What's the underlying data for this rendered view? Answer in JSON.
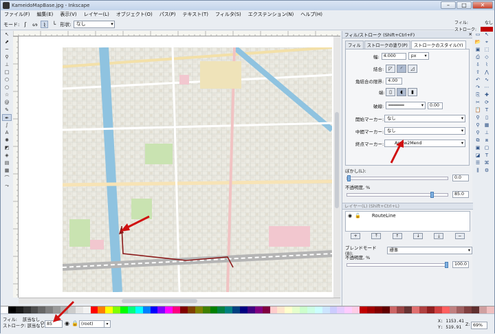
{
  "window": {
    "title": "KameidoMapBase.jpg - Inkscape"
  },
  "menu": [
    "ファイル(F)",
    "編集(E)",
    "表示(V)",
    "レイヤー(L)",
    "オブジェクト(O)",
    "パス(P)",
    "テキスト(T)",
    "フィルタ(S)",
    "エクステンション(N)",
    "ヘルプ(H)"
  ],
  "toolctl": {
    "mode_label": "モード:",
    "shape_label": "形状:",
    "shape_value": "なし"
  },
  "fs_indicator": {
    "fill_label": "フィル:",
    "fill_value": "なし",
    "stroke_label": "ストローク:",
    "stroke_color": "#c00000"
  },
  "dock": {
    "fillstroke_title": "フィル/ストローク (Shift+Ctrl+F)",
    "tabs": [
      "フィル",
      "ストロークの塗り(P)",
      "ストロークのスタイル(Y)"
    ],
    "width_label": "幅:",
    "width_value": "4.000",
    "width_unit": "px",
    "join_label": "結合:",
    "miter_label": "角結合の限界:",
    "miter_value": "4.00",
    "cap_label": "端:",
    "dash_label": "破線:",
    "dash_value": "0.00",
    "start_marker_label": "開始マーカー:",
    "start_marker_value": "なし",
    "mid_marker_label": "中間マーカー:",
    "mid_marker_value": "なし",
    "end_marker_label": "終点マーカー:",
    "end_marker_value": "Arrow2Mend",
    "blur_label": "ぼかし(L):",
    "blur_value": "0.0",
    "blur_fraction": 0.0,
    "opacity_label": "不透明度, %",
    "opacity_value": "85.0",
    "opacity_fraction": 0.85,
    "layers_title": "レイヤー(L) (Shift+Ctrl+L)",
    "layer_name": "RouteLine",
    "blend_label": "ブレンドモード(B):",
    "blend_value": "標準",
    "layer_opacity_label": "不透明度, %",
    "layer_opacity_value": "100.0",
    "layer_opacity_fraction": 1.0
  },
  "status": {
    "fill_label": "フィル:",
    "fill_value": "該当なし",
    "stroke_label": "ストローク:",
    "stroke_value": "該当なし",
    "opacity_label": "O:",
    "opacity_value": "85",
    "layer_value": "(root)",
    "x_label": "X:",
    "x_value": "1153.41",
    "y_label": "Y:",
    "y_value": "519.91",
    "zoom_label": "Z:",
    "zoom_value": "69%"
  },
  "colors": {
    "accent_red": "#c00000",
    "route": "#8b1a1a",
    "river": "#8fc3e0"
  }
}
